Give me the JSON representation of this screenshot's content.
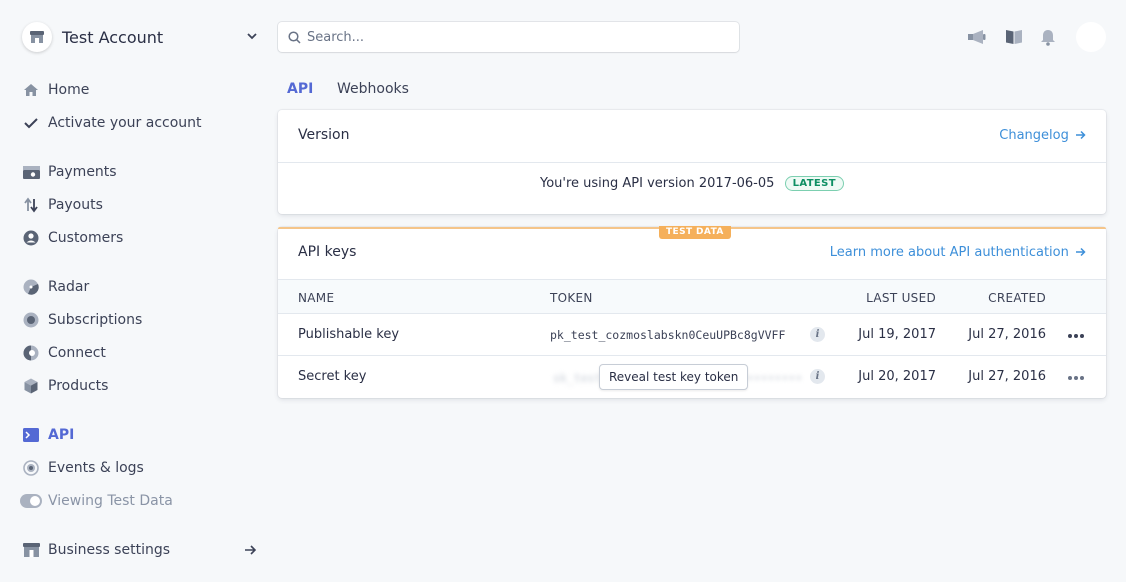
{
  "account": {
    "name": "Test Account"
  },
  "sidebar": {
    "items": [
      {
        "label": "Home"
      },
      {
        "label": "Activate your account"
      },
      {
        "label": "Payments"
      },
      {
        "label": "Payouts"
      },
      {
        "label": "Customers"
      },
      {
        "label": "Radar"
      },
      {
        "label": "Subscriptions"
      },
      {
        "label": "Connect"
      },
      {
        "label": "Products"
      },
      {
        "label": "API"
      },
      {
        "label": "Events & logs"
      },
      {
        "label": "Viewing Test Data"
      },
      {
        "label": "Business settings"
      }
    ]
  },
  "search": {
    "placeholder": "Search..."
  },
  "tabs": [
    {
      "label": "API"
    },
    {
      "label": "Webhooks"
    }
  ],
  "version_card": {
    "title": "Version",
    "link": "Changelog",
    "text": "You're using API version 2017-06-05",
    "badge": "LATEST"
  },
  "keys_card": {
    "badge": "TEST DATA",
    "title": "API keys",
    "link": "Learn more about API authentication",
    "columns": {
      "name": "NAME",
      "token": "TOKEN",
      "last_used": "LAST USED",
      "created": "CREATED"
    },
    "rows": [
      {
        "name": "Publishable key",
        "token": "pk_test_cozmoslabskn0CeuUPBc8gVVFF",
        "last_used": "Jul 19, 2017",
        "created": "Jul 27, 2016"
      },
      {
        "name": "Secret key",
        "token": "sk_test_••••••••••••••••••••••••••••",
        "last_used": "Jul 20, 2017",
        "created": "Jul 27, 2016",
        "reveal_label": "Reveal test key token"
      }
    ]
  },
  "colors": {
    "accent": "#5469d4",
    "link": "#3d8fd9",
    "latest": "#0e8f63",
    "test_data": "#f5b05b"
  },
  "icons": {
    "sidebar": [
      "home-icon",
      "check-icon",
      "payments-icon",
      "payouts-icon",
      "customers-icon",
      "radar-icon",
      "subscriptions-icon",
      "connect-icon",
      "products-icon",
      "api-terminal-icon",
      "events-icon",
      "toggle-switch",
      "business-icon"
    ],
    "top": [
      "megaphone-icon",
      "docs-book-icon",
      "bell-icon"
    ]
  }
}
